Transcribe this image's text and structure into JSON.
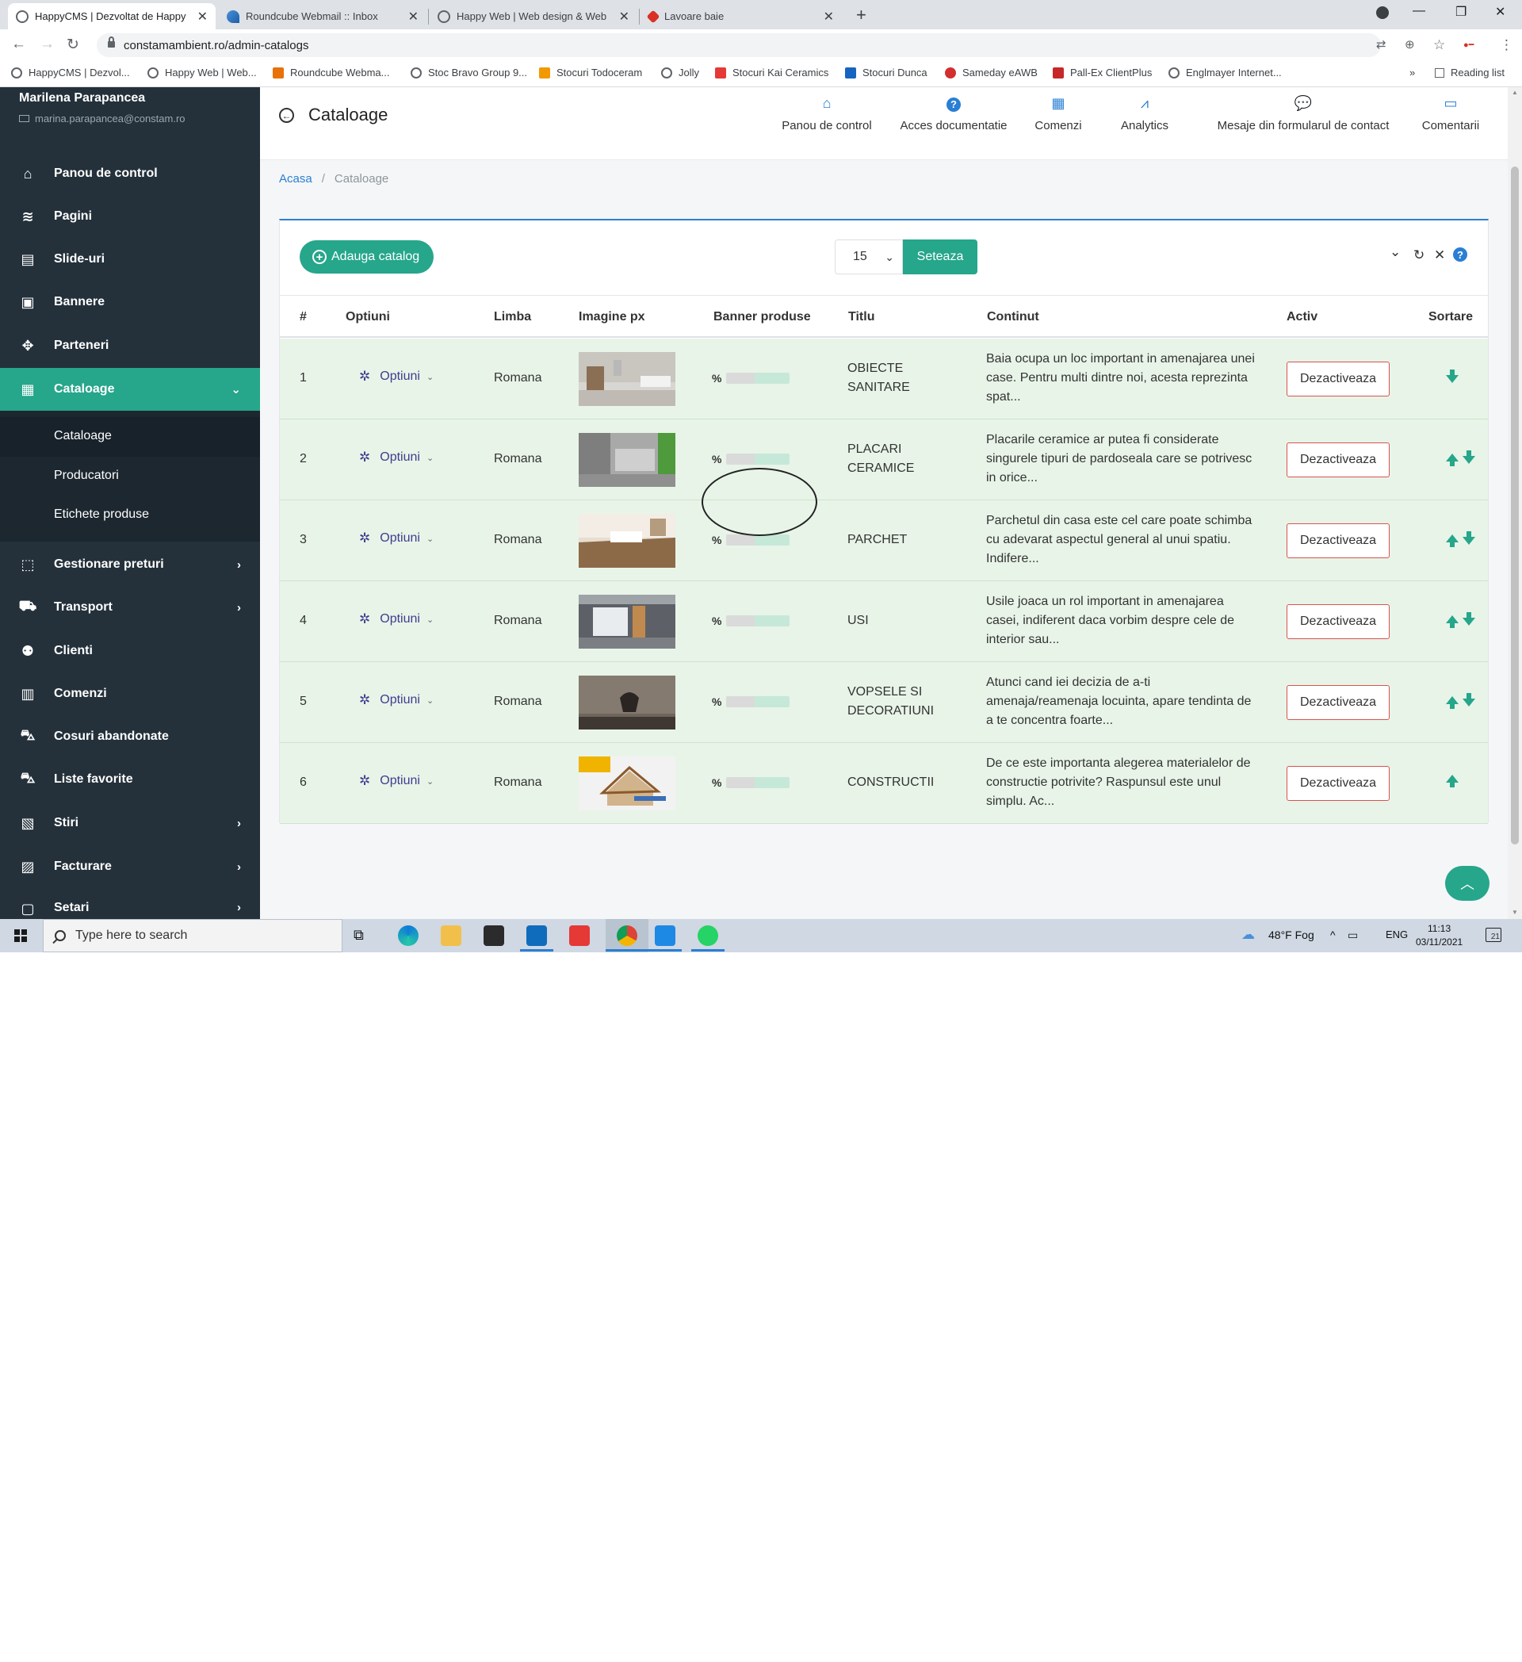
{
  "browser": {
    "tabs": [
      {
        "title": "HappyCMS | Dezvoltat de Happy",
        "close": "✕",
        "active": true
      },
      {
        "title": "Roundcube Webmail :: Inbox",
        "close": "✕",
        "active": false
      },
      {
        "title": "Happy Web | Web design & Web",
        "close": "✕",
        "active": false
      },
      {
        "title": "Lavoare baie",
        "close": "✕",
        "active": false
      }
    ],
    "new_tab": "+",
    "url": "constamambient.ro/admin-catalogs",
    "bookmarks": [
      "HappyCMS | Dezvol...",
      "Happy Web | Web...",
      "Roundcube Webma...",
      "Stoc Bravo Group 9...",
      "Stocuri Todoceram",
      "Jolly",
      "Stocuri Kai Ceramics",
      "Stocuri Dunca",
      "Sameday eAWB",
      "Pall-Ex ClientPlus",
      "Englmayer Internet..."
    ],
    "bookmarks_more": "»",
    "reading_list": "Reading list"
  },
  "sidebar": {
    "user_name": "Marilena Parapancea",
    "user_email": "marina.parapancea@constam.ro",
    "items": [
      {
        "label": "Panou de control",
        "icon": "home-icon"
      },
      {
        "label": "Pagini",
        "icon": "layers-icon"
      },
      {
        "label": "Slide-uri",
        "icon": "slides-icon"
      },
      {
        "label": "Bannere",
        "icon": "image-icon"
      },
      {
        "label": "Parteneri",
        "icon": "handshake-icon"
      },
      {
        "label": "Cataloage",
        "icon": "catalog-icon"
      },
      {
        "label": "Gestionare preturi",
        "icon": "tags-icon"
      },
      {
        "label": "Transport",
        "icon": "truck-icon"
      },
      {
        "label": "Clienti",
        "icon": "users-icon"
      },
      {
        "label": "Comenzi",
        "icon": "cash-register-icon"
      },
      {
        "label": "Cosuri abandonate",
        "icon": "cart-icon"
      },
      {
        "label": "Liste favorite",
        "icon": "cart-plus-icon"
      },
      {
        "label": "Stiri",
        "icon": "news-icon"
      },
      {
        "label": "Facturare",
        "icon": "invoice-icon"
      },
      {
        "label": "Setari",
        "icon": "settings-icon"
      }
    ],
    "submenu": [
      "Cataloage",
      "Producatori",
      "Etichete produse"
    ]
  },
  "header": {
    "title": "Cataloage",
    "quick_links": [
      {
        "label": "Panou de control",
        "icon": "home-icon"
      },
      {
        "label": "Acces documentatie",
        "icon": "question-icon"
      },
      {
        "label": "Comenzi",
        "icon": "calculator-icon"
      },
      {
        "label": "Analytics",
        "icon": "chart-icon"
      },
      {
        "label": "Mesaje din formularul de contact",
        "icon": "chat-icon"
      },
      {
        "label": "Comentarii",
        "icon": "comments-icon"
      }
    ]
  },
  "breadcrumb": {
    "home": "Acasa",
    "separator": "/",
    "current": "Cataloage"
  },
  "toolbar": {
    "add_label": "Adauga catalog",
    "per_page": "15",
    "set_label": "Seteaza"
  },
  "table": {
    "columns": [
      "#",
      "Optiuni",
      "Limba",
      "Imagine px",
      "Banner produse",
      "Titlu",
      "Continut",
      "Activ",
      "Sortare"
    ],
    "options_label": "Optiuni",
    "banner_text": "%",
    "deactivate_label": "Dezactiveaza",
    "rows": [
      {
        "num": "1",
        "lang": "Romana",
        "title": "OBIECTE SANITARE",
        "content": "Baia ocupa un loc important in amenajarea unei case. Pentru multi dintre noi, acesta reprezinta spat...",
        "up": false,
        "down": true
      },
      {
        "num": "2",
        "lang": "Romana",
        "title": "PLACARI CERAMICE",
        "content": "Placarile ceramice ar putea fi considerate singurele tipuri de pardoseala care se potrivesc in orice...",
        "up": true,
        "down": true
      },
      {
        "num": "3",
        "lang": "Romana",
        "title": "PARCHET",
        "content": "Parchetul din casa este cel care poate schimba cu adevarat aspectul general al unui spatiu. Indifere...",
        "up": true,
        "down": true
      },
      {
        "num": "4",
        "lang": "Romana",
        "title": "USI",
        "content": "Usile joaca un rol important in amenajarea casei, indiferent daca vorbim despre cele de interior sau...",
        "up": true,
        "down": true
      },
      {
        "num": "5",
        "lang": "Romana",
        "title": "VOPSELE SI DECORATIUNI",
        "content": "Atunci cand iei decizia de a-ti amenaja/reamenaja locuinta, apare tendinta de a te concentra foarte...",
        "up": true,
        "down": true
      },
      {
        "num": "6",
        "lang": "Romana",
        "title": "CONSTRUCTII",
        "content": "De ce este importanta alegerea materialelor de constructie potrivite? Raspunsul este unul simplu. Ac...",
        "up": true,
        "down": false
      }
    ]
  },
  "taskbar": {
    "search_placeholder": "Type here to search",
    "weather": "48°F Fog",
    "lang": "ENG",
    "time": "11:13",
    "date": "03/11/2021",
    "notifications": "21"
  },
  "colors": {
    "accent": "#26a68b",
    "sidebar": "#24313b",
    "row_bg": "#e8f4e8",
    "link": "#2a7fd4",
    "danger": "#d9534f"
  }
}
